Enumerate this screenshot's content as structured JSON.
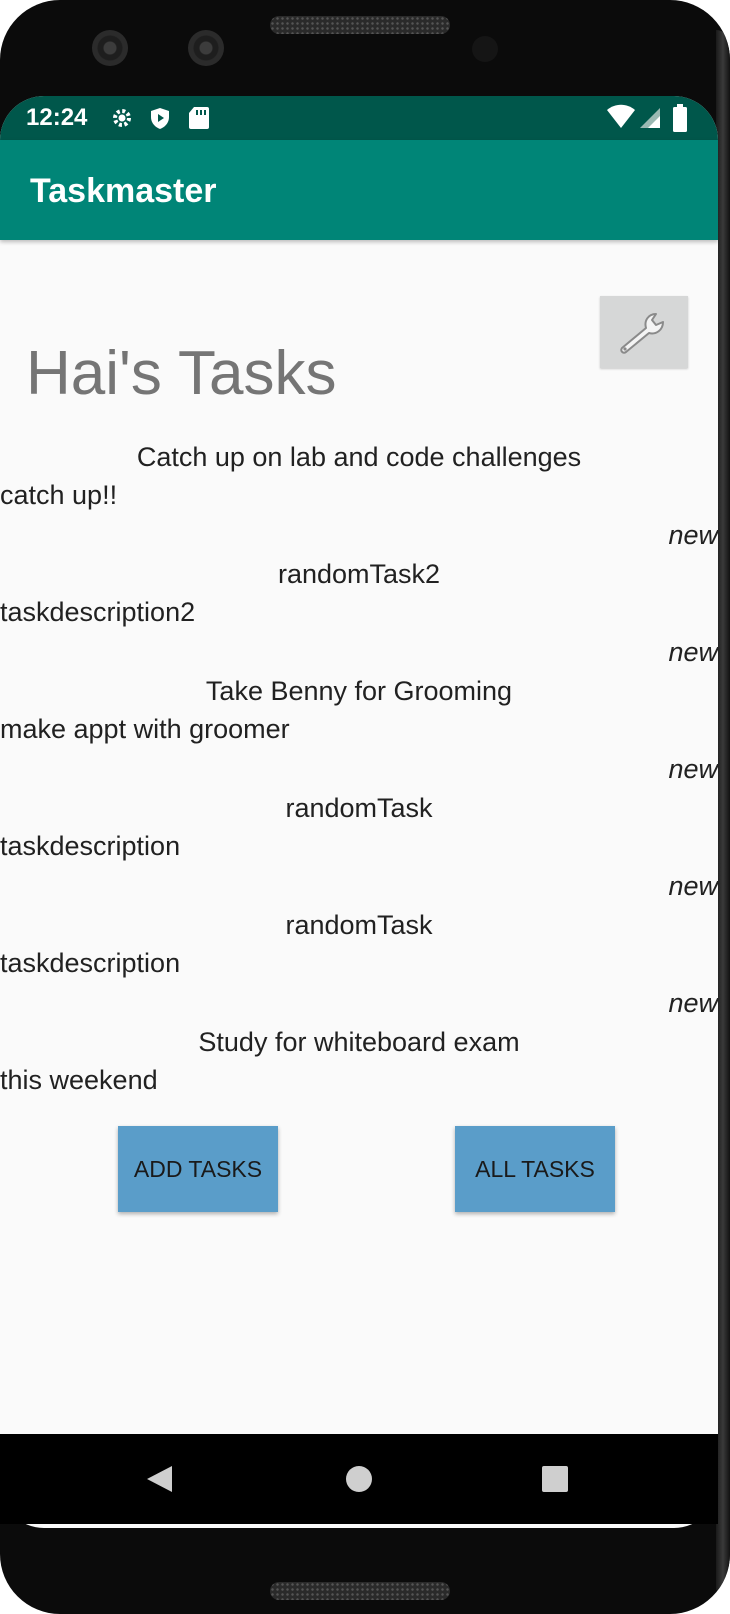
{
  "status_bar": {
    "time": "12:24",
    "icons": [
      "settings-icon",
      "shield-icon",
      "sd-card-icon",
      "wifi-icon",
      "cell-signal-icon",
      "battery-icon"
    ]
  },
  "app_bar": {
    "title": "Taskmaster"
  },
  "settings_button": {
    "icon": "wrench-icon"
  },
  "heading": "Hai's Tasks",
  "tasks": [
    {
      "title": "Catch up on lab and code challenges",
      "body": "catch up!!",
      "state": "new"
    },
    {
      "title": "randomTask2",
      "body": "taskdescription2",
      "state": "new"
    },
    {
      "title": "Take Benny for Grooming",
      "body": "make appt with groomer",
      "state": "new"
    },
    {
      "title": "randomTask",
      "body": "taskdescription",
      "state": "new"
    },
    {
      "title": "randomTask",
      "body": "taskdescription",
      "state": "new"
    },
    {
      "title": "Study for whiteboard exam",
      "body": "this weekend",
      "state": ""
    }
  ],
  "buttons": {
    "add": "ADD TASKS",
    "all": "ALL TASKS"
  },
  "colors": {
    "status_bar": "#00574b",
    "app_bar": "#008577",
    "button": "#5a9dc9"
  }
}
